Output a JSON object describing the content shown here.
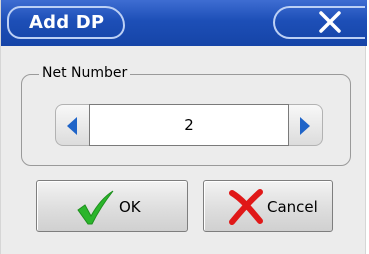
{
  "window": {
    "title": "Add DP"
  },
  "net_number_group": {
    "label": "Net Number",
    "value": "2",
    "decrement_icon": "triangle-left-icon",
    "increment_icon": "triangle-right-icon"
  },
  "buttons": {
    "ok_label": "OK",
    "ok_icon": "checkmark-icon",
    "cancel_label": "Cancel",
    "cancel_icon": "x-icon"
  },
  "colors": {
    "titlebar": "#1d4fb7",
    "arrow": "#1f64c8",
    "check": "#2bb52b",
    "cancel_x": "#e01818",
    "dialog_bg": "#ececec"
  }
}
